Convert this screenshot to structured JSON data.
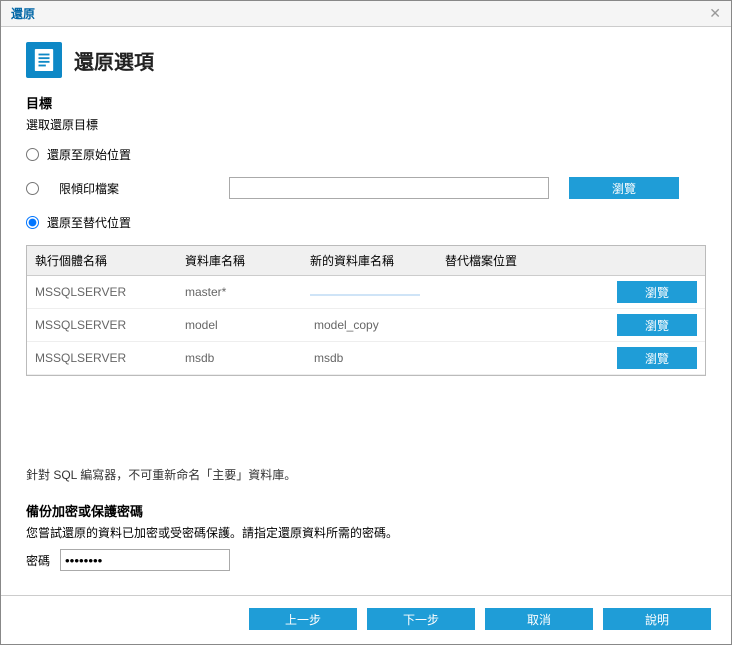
{
  "dialog": {
    "title": "還原",
    "close": "✕"
  },
  "header": {
    "title": "還原選項"
  },
  "target": {
    "label": "目標",
    "subtitle": "選取還原目標"
  },
  "radios": {
    "original": "還原至原始位置",
    "dump": "限傾印檔案",
    "alternate": "還原至替代位置"
  },
  "browse": {
    "value": "",
    "button": "瀏覽"
  },
  "table": {
    "headers": {
      "instance": "執行個體名稱",
      "database": "資料庫名稱",
      "newdb": "新的資料庫名稱",
      "altfile": "替代檔案位置"
    },
    "browseBtn": "瀏覽",
    "rows": [
      {
        "instance": "MSSQLSERVER",
        "db": "master*",
        "newdb": "",
        "selected": true
      },
      {
        "instance": "MSSQLSERVER",
        "db": "model",
        "newdb": "model_copy",
        "selected": false
      },
      {
        "instance": "MSSQLSERVER",
        "db": "msdb",
        "newdb": "msdb",
        "selected": false
      }
    ]
  },
  "note": "針對 SQL 編寫器，不可重新命名「主要」資料庫。",
  "password": {
    "title": "備份加密或保護密碼",
    "desc": "您嘗試還原的資料已加密或受密碼保護。請指定還原資料所需的密碼。",
    "label": "密碼",
    "value": "••••••••"
  },
  "footer": {
    "prev": "上一步",
    "next": "下一步",
    "cancel": "取消",
    "help": "說明"
  }
}
